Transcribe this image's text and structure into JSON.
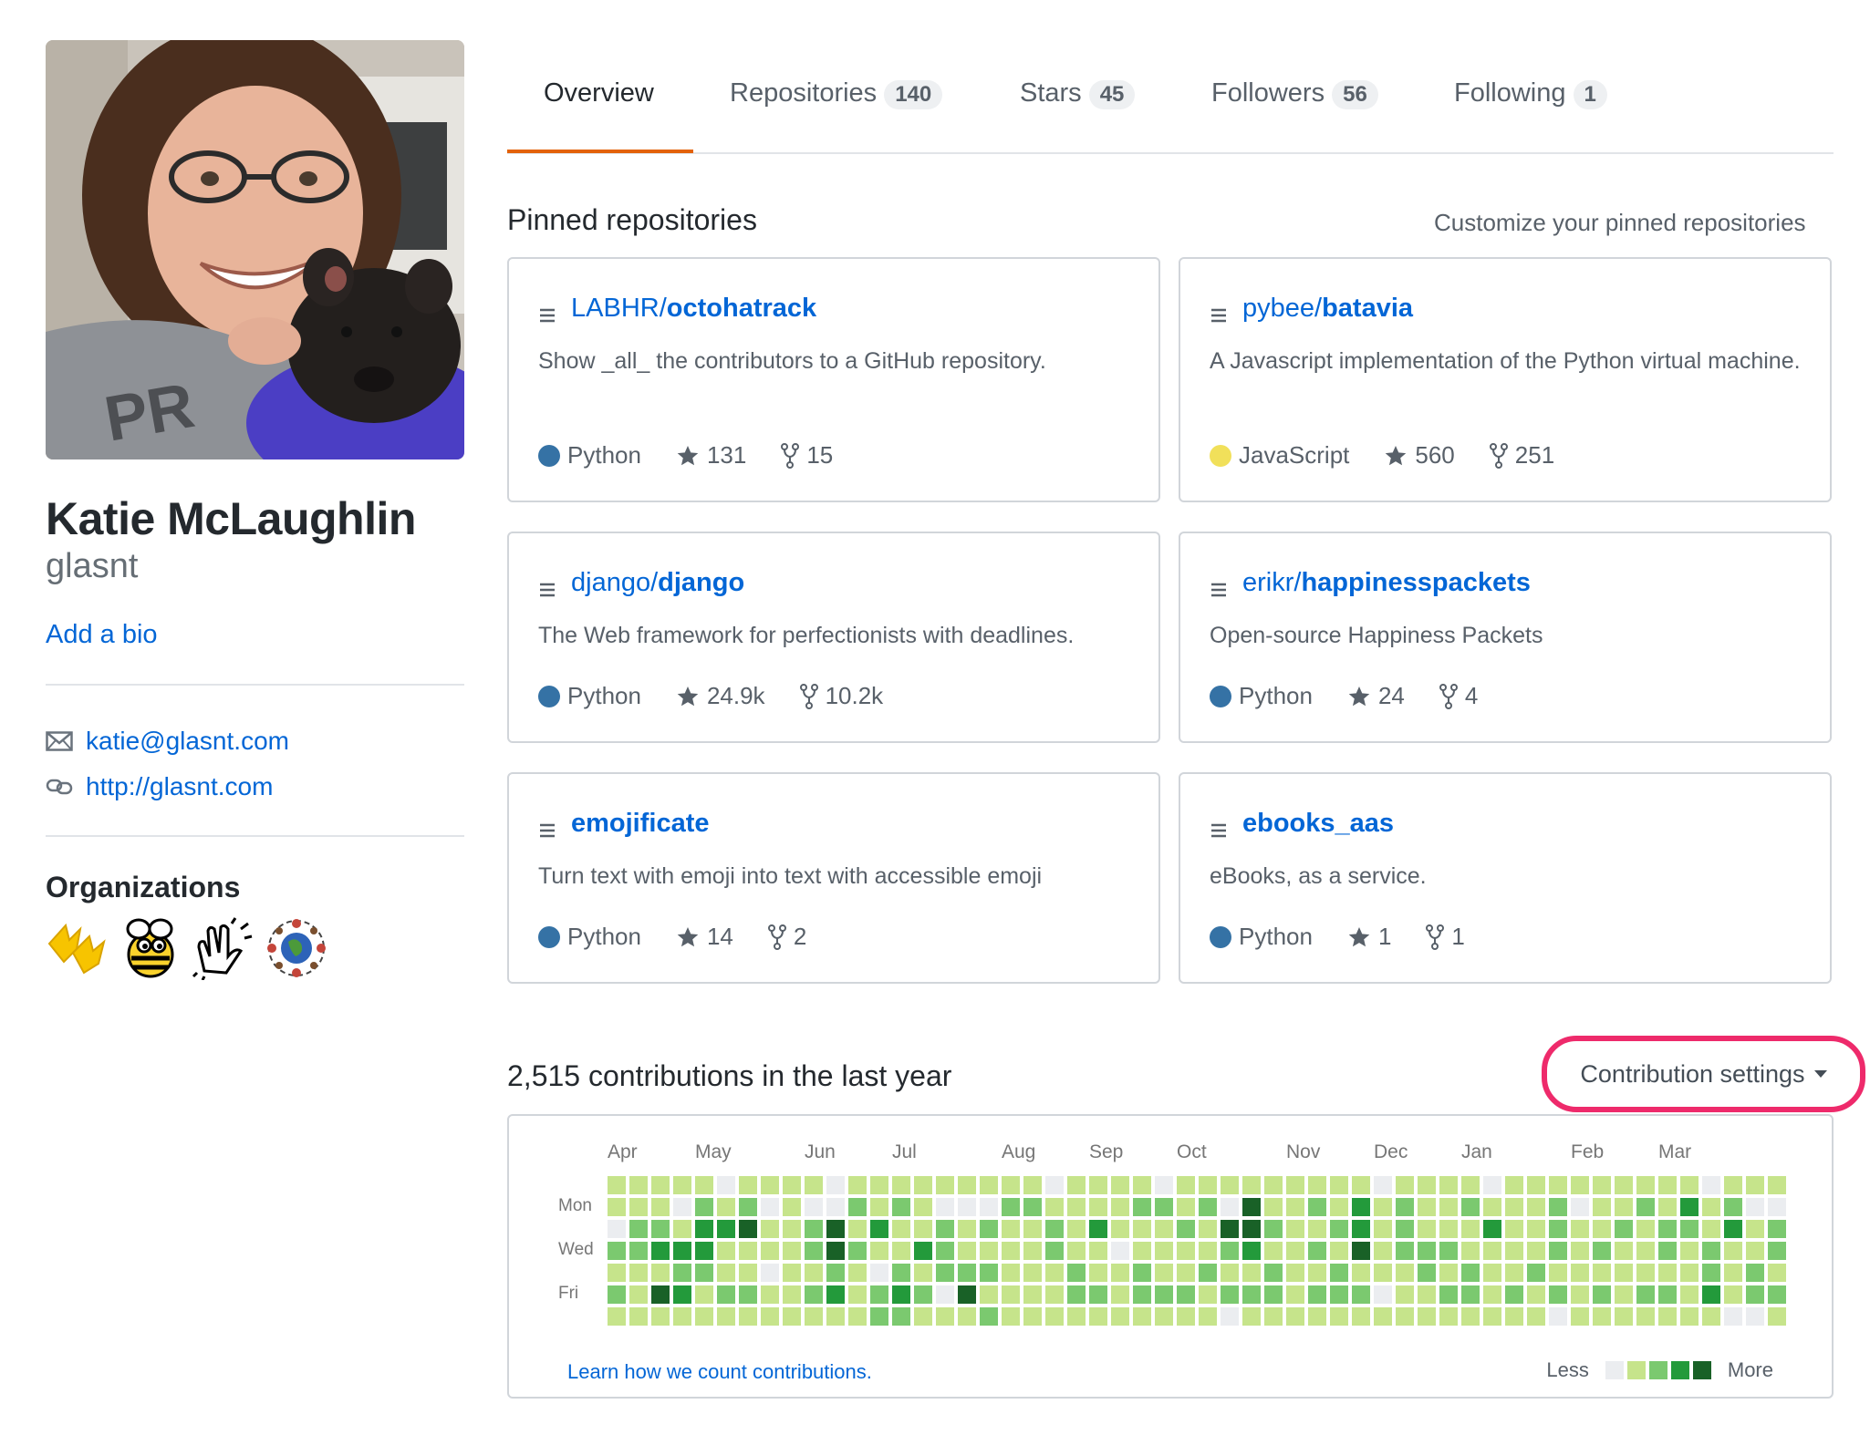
{
  "profile": {
    "full_name": "Katie McLaughlin",
    "username": "glasnt",
    "add_bio": "Add a bio",
    "email": "katie@glasnt.com",
    "website": "http://glasnt.com",
    "organizations_title": "Organizations",
    "organizations": [
      "duck-feet-org-icon",
      "bee-org-icon",
      "clapping-hands-org-icon",
      "globe-people-org-icon"
    ]
  },
  "tabs": [
    {
      "label": "Overview",
      "count": null,
      "selected": true
    },
    {
      "label": "Repositories",
      "count": "140",
      "selected": false
    },
    {
      "label": "Stars",
      "count": "45",
      "selected": false
    },
    {
      "label": "Followers",
      "count": "56",
      "selected": false
    },
    {
      "label": "Following",
      "count": "1",
      "selected": false
    }
  ],
  "pinned": {
    "title": "Pinned repositories",
    "customize": "Customize your pinned repositories",
    "repos": [
      {
        "owner": "LABHR/",
        "name": "octohatrack",
        "description": "Show _all_ the contributors to a GitHub repository.",
        "language": "Python",
        "lang_color": "#3572A5",
        "stars": "131",
        "forks": "15"
      },
      {
        "owner": "pybee/",
        "name": "batavia",
        "description": "A Javascript implementation of the Python virtual machine.",
        "language": "JavaScript",
        "lang_color": "#f1e05a",
        "stars": "560",
        "forks": "251"
      },
      {
        "owner": "django/",
        "name": "django",
        "description": "The Web framework for perfectionists with deadlines.",
        "language": "Python",
        "lang_color": "#3572A5",
        "stars": "24.9k",
        "forks": "10.2k"
      },
      {
        "owner": "erikr/",
        "name": "happinesspackets",
        "description": "Open-source Happiness Packets",
        "language": "Python",
        "lang_color": "#3572A5",
        "stars": "24",
        "forks": "4"
      },
      {
        "owner": "",
        "name": "emojificate",
        "description": "Turn text with emoji into text with accessible emoji",
        "language": "Python",
        "lang_color": "#3572A5",
        "stars": "14",
        "forks": "2"
      },
      {
        "owner": "",
        "name": "ebooks_aas",
        "description": "eBooks, as a service.",
        "language": "Python",
        "lang_color": "#3572A5",
        "stars": "1",
        "forks": "1"
      }
    ]
  },
  "contributions": {
    "title": "2,515 contributions in the last year",
    "settings_label": "Contribution settings",
    "months": [
      "Apr",
      "May",
      "Jun",
      "Jul",
      "Aug",
      "Sep",
      "Oct",
      "Nov",
      "Dec",
      "Jan",
      "Feb",
      "Mar"
    ],
    "days": [
      "Mon",
      "Wed",
      "Fri"
    ],
    "learn_link": "Learn how we count contributions.",
    "legend_less": "Less",
    "legend_more": "More",
    "level_colors": [
      "#ebedf0",
      "#c6e48b",
      "#7bc96f",
      "#239a3b",
      "#196127"
    ],
    "weeks": [
      [
        1,
        0,
        2,
        1,
        2,
        1
      ],
      [
        1,
        2,
        2,
        1,
        1,
        1
      ],
      [
        1,
        2,
        3,
        1,
        4,
        1
      ],
      [
        0,
        1,
        3,
        2,
        3,
        1
      ],
      [
        2,
        3,
        3,
        2,
        1,
        1
      ],
      [
        1,
        3,
        1,
        1,
        2,
        1
      ],
      [
        2,
        4,
        1,
        1,
        2,
        1
      ],
      [
        0,
        1,
        1,
        0,
        1,
        1
      ],
      [
        1,
        1,
        1,
        1,
        1,
        1
      ],
      [
        0,
        2,
        2,
        1,
        2,
        1
      ],
      [
        0,
        4,
        4,
        2,
        3,
        1
      ],
      [
        2,
        1,
        2,
        1,
        1,
        1
      ],
      [
        1,
        3,
        1,
        0,
        2,
        2
      ],
      [
        2,
        1,
        1,
        2,
        3,
        2
      ],
      [
        1,
        1,
        3,
        1,
        2,
        1
      ],
      [
        0,
        2,
        2,
        2,
        0,
        1
      ],
      [
        0,
        1,
        1,
        2,
        4,
        1
      ],
      [
        0,
        2,
        1,
        2,
        1,
        2
      ],
      [
        2,
        1,
        1,
        1,
        1,
        1
      ],
      [
        2,
        1,
        1,
        1,
        1,
        1
      ],
      [
        1,
        2,
        2,
        1,
        1,
        1
      ],
      [
        1,
        1,
        1,
        2,
        2,
        1
      ],
      [
        1,
        3,
        1,
        1,
        2,
        1
      ],
      [
        1,
        1,
        0,
        1,
        1,
        1
      ],
      [
        2,
        1,
        1,
        2,
        2,
        1
      ],
      [
        2,
        1,
        1,
        1,
        2,
        1
      ],
      [
        1,
        2,
        1,
        1,
        2,
        1
      ],
      [
        2,
        1,
        1,
        2,
        1,
        1
      ],
      [
        0,
        4,
        2,
        1,
        2,
        0
      ],
      [
        4,
        4,
        3,
        1,
        2,
        1
      ],
      [
        1,
        2,
        1,
        2,
        2,
        1
      ],
      [
        1,
        1,
        1,
        1,
        1,
        1
      ],
      [
        2,
        1,
        2,
        1,
        2,
        1
      ],
      [
        1,
        2,
        1,
        2,
        2,
        1
      ],
      [
        3,
        3,
        4,
        1,
        2,
        1
      ],
      [
        1,
        1,
        1,
        1,
        0,
        1
      ],
      [
        2,
        2,
        2,
        1,
        1,
        1
      ],
      [
        1,
        1,
        2,
        2,
        1,
        1
      ],
      [
        1,
        1,
        2,
        1,
        2,
        1
      ],
      [
        2,
        1,
        1,
        2,
        2,
        1
      ],
      [
        1,
        3,
        1,
        1,
        1,
        1
      ],
      [
        1,
        1,
        1,
        1,
        2,
        1
      ],
      [
        1,
        1,
        1,
        2,
        1,
        1
      ],
      [
        2,
        2,
        2,
        1,
        2,
        0
      ],
      [
        0,
        1,
        1,
        1,
        1,
        1
      ],
      [
        1,
        1,
        2,
        1,
        2,
        1
      ],
      [
        1,
        2,
        1,
        1,
        1,
        1
      ],
      [
        2,
        1,
        1,
        1,
        2,
        1
      ],
      [
        1,
        2,
        2,
        1,
        2,
        1
      ],
      [
        3,
        2,
        1,
        1,
        1,
        1
      ],
      [
        1,
        1,
        2,
        2,
        3,
        1
      ],
      [
        2,
        3,
        1,
        1,
        1,
        0
      ],
      [
        0,
        1,
        1,
        2,
        2,
        0
      ],
      [
        0,
        2,
        2,
        1,
        2,
        1
      ]
    ]
  }
}
